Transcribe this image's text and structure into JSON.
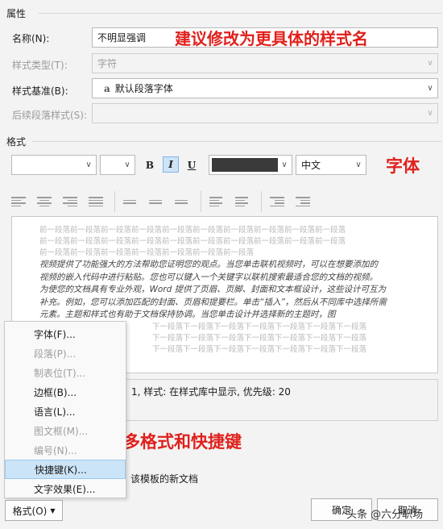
{
  "properties": {
    "section_title": "属性",
    "name_label": "名称(N):",
    "name_value": "不明显强调",
    "type_label": "样式类型(T):",
    "type_value": "字符",
    "base_label": "样式基准(B):",
    "base_value": "默认段落字体",
    "base_glyph": "a",
    "next_label": "后续段落样式(S):"
  },
  "format": {
    "section_title": "格式",
    "bold": "B",
    "italic": "I",
    "underline": "U",
    "language": "中文",
    "font_color": "#3a3a3a"
  },
  "preview": {
    "prev_lines": [
      "前一段落前一段落前一段落前一段落前一段落前一段落前一段落前一段落前一段落前一段落",
      "前一段落前一段落前一段落前一段落前一段落前一段落前一段落前一段落前一段落前一段落",
      "前一段落前一段落前一段落前一段落前一段落前一段落前一段落"
    ],
    "sample_lines": [
      "视频提供了功能强大的方法帮助您证明您的观点。当您单击联机视频时，可以在想要添加的",
      "视频的嵌入代码中进行粘贴。您也可以键入一个关键字以联机搜索最适合您的文档的视频。",
      "为使您的文档具有专业外观，Word 提供了页眉、页脚、封面和文本框设计，这些设计可互为",
      "补充。例如，您可以添加匹配的封面、页眉和提要栏。单击“插入”，然后从不同库中选择所需",
      "元素。主题和样式也有助于文档保持协调。当您单击设计并选择新的主题时，图"
    ],
    "next_lines": [
      "下一段落下一段落下一段落下一段落下一段落下一段落下一段落",
      "下一段落下一段落下一段落下一段落下一段落下一段落下一段落",
      "下一段落下一段落下一段落下一段落下一段落下一段落下一段落"
    ]
  },
  "description": "字体: 1, 样式: 在样式库中显示, 优先级: 20",
  "description_visible": "1, 样式: 在样式库中显示, 优先级: 20",
  "template_option": "该模板的新文档",
  "menu": {
    "items": [
      {
        "label": "字体(F)...",
        "enabled": true
      },
      {
        "label": "段落(P)...",
        "enabled": false
      },
      {
        "label": "制表位(T)...",
        "enabled": false
      },
      {
        "label": "边框(B)...",
        "enabled": true
      },
      {
        "label": "语言(L)...",
        "enabled": true
      },
      {
        "label": "图文框(M)...",
        "enabled": false
      },
      {
        "label": "编号(N)...",
        "enabled": false
      },
      {
        "label": "快捷键(K)...",
        "enabled": true,
        "highlighted": true
      },
      {
        "label": "文字效果(E)...",
        "enabled": true
      }
    ]
  },
  "buttons": {
    "format": "格式(O)",
    "ok": "确定",
    "cancel": "取消"
  },
  "annotations": {
    "a1": "建议修改为更具体的样式名",
    "a2": "字体",
    "a3": "更多格式和快捷键"
  },
  "watermark": "头条 @六分职场"
}
